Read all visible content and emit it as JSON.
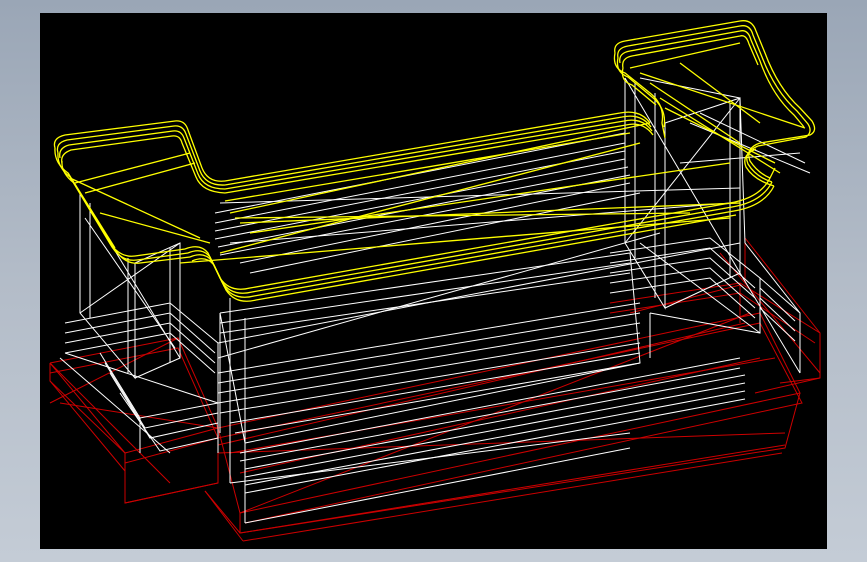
{
  "viewport": {
    "background": "#000000",
    "frame_color": "#aab4c2"
  },
  "model": {
    "render_mode": "wireframe",
    "layers": [
      {
        "name": "top-cap",
        "color": "#ffff00"
      },
      {
        "name": "body",
        "color": "#ffffff"
      },
      {
        "name": "base",
        "color": "#cc0000"
      }
    ]
  }
}
